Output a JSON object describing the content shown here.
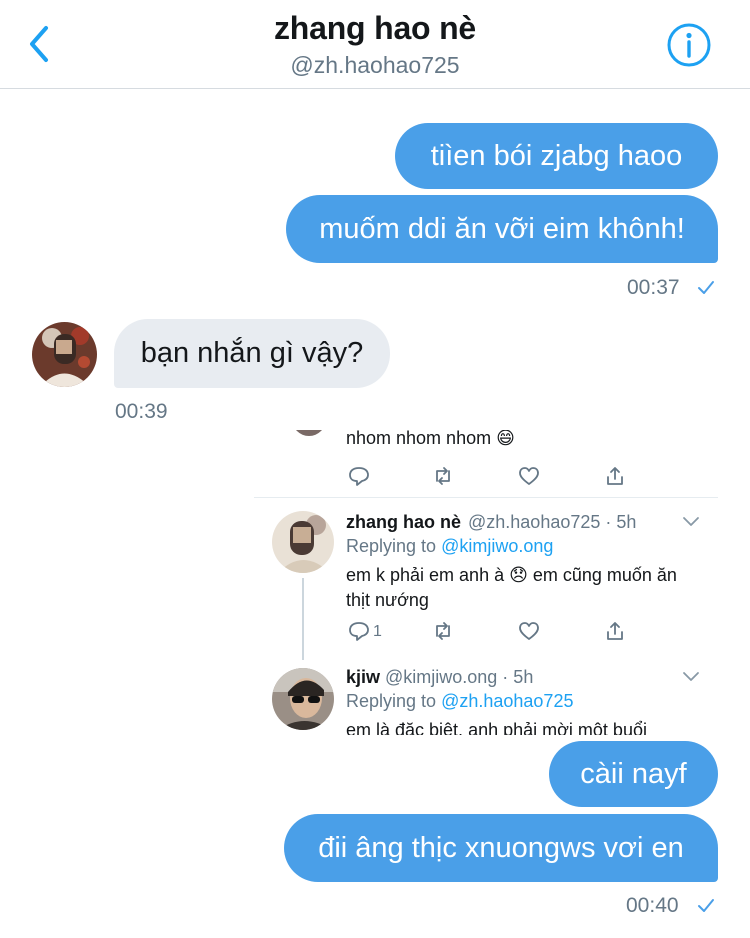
{
  "header": {
    "title": "zhang hao nè",
    "handle": "@zh.haohao725"
  },
  "messages": {
    "m1": "tiìen bói zjabg haoo",
    "m2": "muốm ddi ăn vỡi eim khônh!",
    "t1": "00:37",
    "m3": "bạn nhắn gì vậy?",
    "t2": "00:39",
    "m4": "càii nayf",
    "m5": "đii âng thịc xnuongws vơi en",
    "t3": "00:40"
  },
  "embedded_screenshot": {
    "top_text": "nhom nhom nhom 😄",
    "tweet1": {
      "name": "zhang hao nè",
      "meta": "@zh.haohao725 · 5h",
      "replying_prefix": "Replying to",
      "replying_to": "@kimjiwo.ong",
      "text_line1": "em k phải em anh à 😞 em cũng muốn ăn",
      "text_line2": "thịt nướng",
      "reply_count": "1"
    },
    "tweet2": {
      "name": "kjiw",
      "meta": "@kimjiwo.ong · 5h",
      "replying_prefix": "Replying to",
      "replying_to": "@zh.haohao725",
      "text_line1": "em là đặc biệt, anh phải mời một buổi"
    }
  },
  "colors": {
    "accent": "#4a9fe8",
    "incoming_bubble": "#e8ecf1",
    "link": "#1da1f2",
    "muted": "#657786"
  },
  "icons": [
    "back-chevron-icon",
    "info-icon",
    "read-check-icon",
    "reply-icon",
    "retweet-icon",
    "like-icon",
    "share-icon",
    "chevron-down-icon"
  ]
}
